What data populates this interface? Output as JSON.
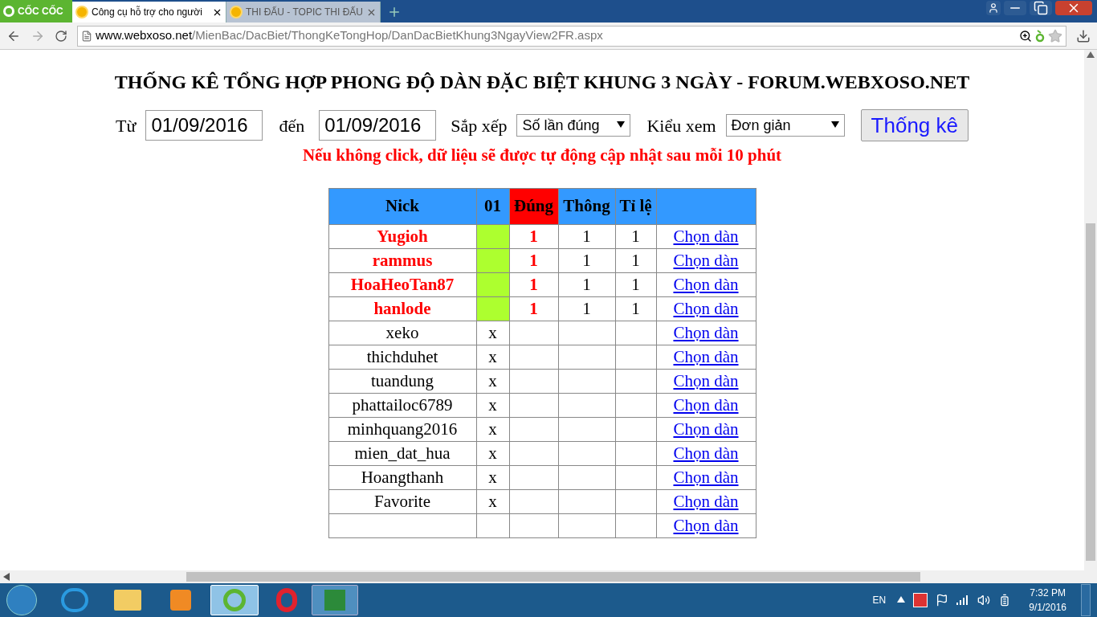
{
  "browser": {
    "brand": "CỐC CỐC",
    "tabs": [
      {
        "label": "Công cụ hỗ trợ cho người",
        "selected": true
      },
      {
        "label": "THI ĐẤU - TOPIC THI ĐẤU",
        "selected": false
      }
    ],
    "url_host": "www.webxoso.net",
    "url_path": "/MienBac/DacBiet/ThongKeTongHop/DanDacBietKhung3NgayView2FR.aspx"
  },
  "page": {
    "title": "THỐNG KÊ TỔNG HỢP PHONG ĐỘ DÀN ĐẶC BIỆT KHUNG 3 NGÀY - FORUM.WEBXOSO.NET",
    "filters": {
      "from_label": "Từ",
      "from_value": "01/09/2016",
      "to_label": "đến",
      "to_value": "01/09/2016",
      "sort_label": "Sắp xếp",
      "sort_value": "Số lần đúng",
      "view_label": "Kiểu xem",
      "view_value": "Đơn giản",
      "submit": "Thống kê"
    },
    "notice": "Nếu không click, dữ liệu sẽ được tự động cập nhật sau mỗi 10 phút",
    "table": {
      "columns": [
        "Nick",
        "01",
        "Đúng",
        "Thông",
        "Tỉ lệ"
      ],
      "rows": [
        {
          "nick": "Yugioh",
          "hit": true,
          "col_01": "",
          "dung": "1",
          "thong": "1",
          "ti_le": "1",
          "link": "Chọn dàn"
        },
        {
          "nick": "rammus",
          "hit": true,
          "col_01": "",
          "dung": "1",
          "thong": "1",
          "ti_le": "1",
          "link": "Chọn dàn"
        },
        {
          "nick": "HoaHeoTan87",
          "hit": true,
          "col_01": "",
          "dung": "1",
          "thong": "1",
          "ti_le": "1",
          "link": "Chọn dàn"
        },
        {
          "nick": "hanlode",
          "hit": true,
          "col_01": "",
          "dung": "1",
          "thong": "1",
          "ti_le": "1",
          "link": "Chọn dàn"
        },
        {
          "nick": "xeko",
          "hit": false,
          "col_01": "x",
          "dung": "",
          "thong": "",
          "ti_le": "",
          "link": "Chọn dàn"
        },
        {
          "nick": "thichduhet",
          "hit": false,
          "col_01": "x",
          "dung": "",
          "thong": "",
          "ti_le": "",
          "link": "Chọn dàn"
        },
        {
          "nick": "tuandung",
          "hit": false,
          "col_01": "x",
          "dung": "",
          "thong": "",
          "ti_le": "",
          "link": "Chọn dàn"
        },
        {
          "nick": "phattailoc6789",
          "hit": false,
          "col_01": "x",
          "dung": "",
          "thong": "",
          "ti_le": "",
          "link": "Chọn dàn"
        },
        {
          "nick": "minhquang2016",
          "hit": false,
          "col_01": "x",
          "dung": "",
          "thong": "",
          "ti_le": "",
          "link": "Chọn dàn"
        },
        {
          "nick": "mien_dat_hua",
          "hit": false,
          "col_01": "x",
          "dung": "",
          "thong": "",
          "ti_le": "",
          "link": "Chọn dàn"
        },
        {
          "nick": "Hoangthanh",
          "hit": false,
          "col_01": "x",
          "dung": "",
          "thong": "",
          "ti_le": "",
          "link": "Chọn dàn"
        },
        {
          "nick": "Favorite",
          "hit": false,
          "col_01": "x",
          "dung": "",
          "thong": "",
          "ti_le": "",
          "link": "Chọn dàn"
        },
        {
          "nick": "",
          "hit": false,
          "col_01": "",
          "dung": "",
          "thong": "",
          "ti_le": "",
          "link": "Chọn dàn"
        }
      ]
    }
  },
  "taskbar": {
    "language": "EN",
    "time": "7:32 PM",
    "date": "9/1/2016"
  }
}
